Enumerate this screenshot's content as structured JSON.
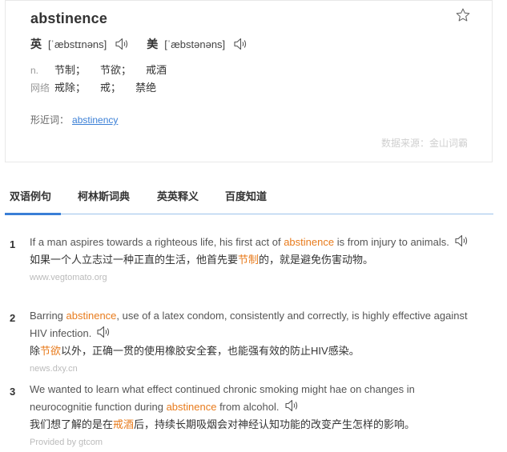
{
  "entry": {
    "word": "abstinence",
    "uk": {
      "label": "英",
      "ipa": "[ˈæbstɪnəns]"
    },
    "us": {
      "label": "美",
      "ipa": "[ˈæbstənəns]"
    },
    "definitions": [
      {
        "pos": "n.",
        "items": [
          "节制",
          "节欲",
          "戒酒"
        ]
      },
      {
        "pos": "网络",
        "items": [
          "戒除",
          "戒",
          "禁绝"
        ]
      }
    ],
    "similar_label": "形近词：",
    "similar_word": "abstinency",
    "source": "数据来源：金山词霸"
  },
  "tabs": [
    "双语例句",
    "柯林斯词典",
    "英英释义",
    "百度知道"
  ],
  "examples": [
    {
      "num": "1",
      "en_before": "If a man aspires towards a righteous life, his first act of ",
      "en_highlight": "abstinence",
      "en_after": " is from injury to animals.",
      "zh_before": "如果一个人立志过一种正直的生活，他首先要",
      "zh_highlight": "节制",
      "zh_after": "的，就是避免伤害动物。",
      "source": "www.vegtomato.org"
    },
    {
      "num": "2",
      "en_before": "Barring ",
      "en_highlight": "abstinence",
      "en_after": ", use of a latex condom, consistently and correctly, is highly effective against HIV infection.",
      "zh_before": "除",
      "zh_highlight": "节欲",
      "zh_after": "以外，正确一贯的使用橡胶安全套，也能强有效的防止HIV感染。",
      "source": "news.dxy.cn"
    },
    {
      "num": "3",
      "en_before": "We wanted to learn what effect continued chronic smoking might hae on changes in neurocognitie function during ",
      "en_highlight": "abstinence",
      "en_after": " from alcohol.",
      "zh_before": "我们想了解的是在",
      "zh_highlight": "戒酒",
      "zh_after": "后，持续长期吸烟会对神经认知功能的改变产生怎样的影响。",
      "source": "Provided by gtcom"
    }
  ]
}
